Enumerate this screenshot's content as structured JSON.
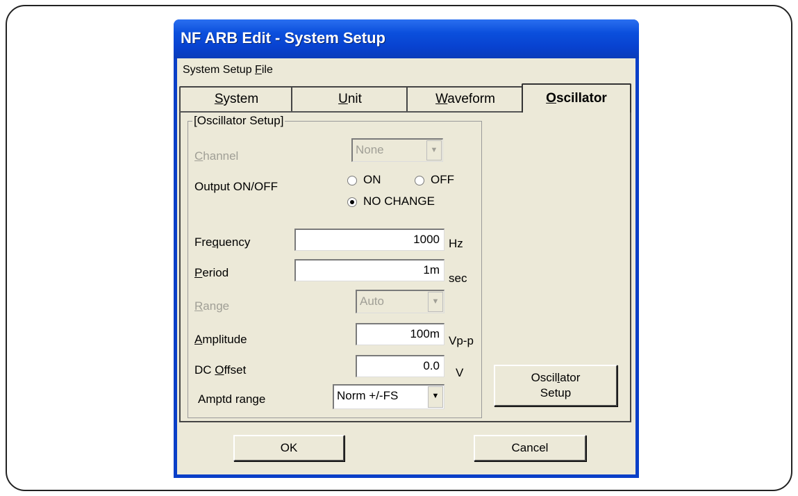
{
  "window": {
    "title": "NF ARB Edit - System Setup"
  },
  "menu": {
    "item": "System Setup File"
  },
  "tabs": [
    "System",
    "Unit",
    "Waveform",
    "Oscillator"
  ],
  "group": {
    "title": "[Oscillator Setup]"
  },
  "fields": {
    "channel": {
      "label": "Channel",
      "value": "None"
    },
    "output": {
      "label": "Output ON/OFF",
      "options": [
        "ON",
        "OFF",
        "NO CHANGE"
      ],
      "selected": "NO CHANGE"
    },
    "frequency": {
      "label": "Frequency",
      "value": "1000",
      "unit": "Hz"
    },
    "period": {
      "label": "Period",
      "value": "1m",
      "unit": "sec"
    },
    "range": {
      "label": "Range",
      "value": "Auto"
    },
    "amplitude": {
      "label": "Amplitude",
      "value": "100m",
      "unit": "Vp-p"
    },
    "dc_offset": {
      "label": "DC Offset",
      "value": "0.0",
      "unit": "V"
    },
    "amptd_range": {
      "label": "Amptd range",
      "value": "Norm +/-FS"
    }
  },
  "buttons": {
    "setup_line1": "Oscillator",
    "setup_line2": "Setup",
    "ok": "OK",
    "cancel": "Cancel"
  },
  "icons": {
    "dropdown": "chevron-down-icon",
    "radio_selected": "radio-selected",
    "radio_empty": "radio-empty"
  },
  "colors": {
    "titlebar": "#0b4fdc",
    "dialog_bg": "#ece9d8",
    "disabled_text": "#a09f96"
  }
}
